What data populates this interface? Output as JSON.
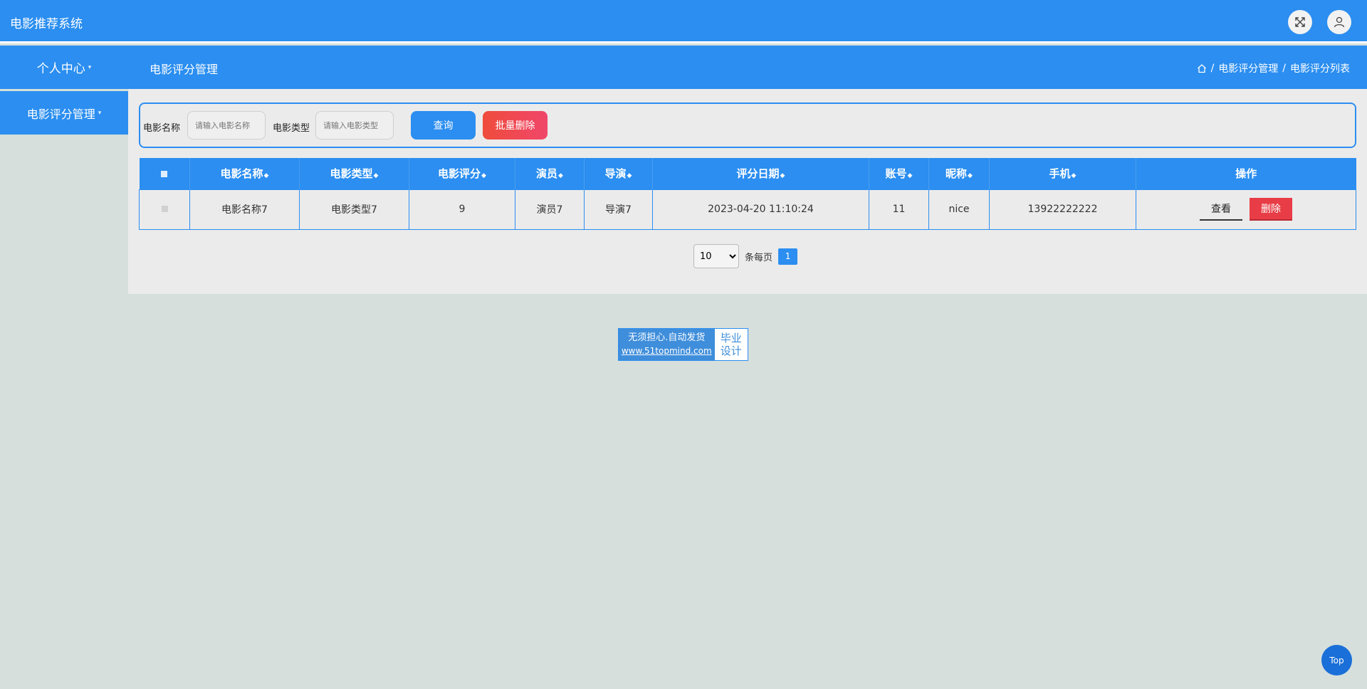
{
  "header": {
    "title": "电影推荐系统"
  },
  "nav": {
    "personal_center": "个人中心",
    "page_title": "电影评分管理",
    "breadcrumb": {
      "sep": "/",
      "level1": "电影评分管理",
      "level2": "电影评分列表"
    }
  },
  "sidebar": {
    "items": [
      {
        "label": "电影评分管理"
      }
    ]
  },
  "search": {
    "name_label": "电影名称",
    "name_placeholder": "请输入电影名称",
    "type_label": "电影类型",
    "type_placeholder": "请输入电影类型",
    "query_button": "查询",
    "batch_delete_button": "批量删除"
  },
  "table": {
    "columns": [
      "电影名称",
      "电影类型",
      "电影评分",
      "演员",
      "导演",
      "评分日期",
      "账号",
      "昵称",
      "手机",
      "操作"
    ],
    "rows": [
      {
        "name": "电影名称7",
        "type": "电影类型7",
        "score": "9",
        "actor": "演员7",
        "director": "导演7",
        "date": "2023-04-20 11:10:24",
        "account": "11",
        "nickname": "nice",
        "phone": "13922222222"
      }
    ],
    "view_button": "查看",
    "delete_button": "删除"
  },
  "pager": {
    "page_size": "10",
    "page_size_options": [
      "10"
    ],
    "per_page_label": "条每页",
    "current_page": "1"
  },
  "watermark": {
    "line1": "无须担心.自动发货",
    "url": "www.51topmind.com",
    "side1": "毕业",
    "side2": "设计"
  },
  "top_button": "Top",
  "colors": {
    "primary": "#2b8ef0",
    "danger": "#e83d46"
  },
  "icons": {
    "fullscreen": "fullscreen-icon",
    "user": "user-icon",
    "home": "home-icon"
  }
}
